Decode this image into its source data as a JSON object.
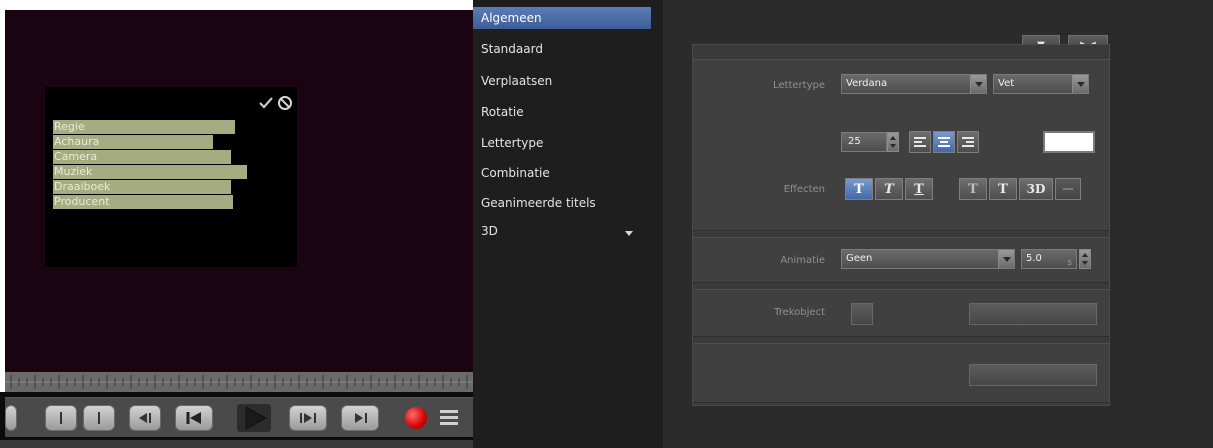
{
  "preview": {
    "title_lines": [
      "Regie",
      "Achaura",
      "Camera",
      "Muziek",
      "Draaiboek",
      "Producent"
    ]
  },
  "transport": {
    "buttons": [
      {
        "icon": "mark-in-icon"
      },
      {
        "icon": "mark-out-icon"
      },
      {
        "icon": "go-to-start-icon"
      },
      {
        "icon": "previous-marker-icon"
      },
      {
        "icon": "play-icon"
      },
      {
        "icon": "next-marker-icon"
      },
      {
        "icon": "go-to-end-icon"
      },
      {
        "icon": "record-icon"
      },
      {
        "icon": "menu-icon"
      }
    ]
  },
  "menu": {
    "items": [
      {
        "label": "Algemeen",
        "selected": true
      },
      {
        "label": "Standaard"
      },
      {
        "label": "Verplaatsen"
      },
      {
        "label": "Rotatie"
      },
      {
        "label": "Lettertype"
      },
      {
        "label": "Combinatie"
      },
      {
        "label": "Geanimeerde titels"
      },
      {
        "label": "3D"
      }
    ]
  },
  "props": {
    "top_buttons": [
      {
        "label": "▼"
      },
      {
        "label": "▶◀"
      }
    ],
    "font_section": {
      "lettertype_label": "Lettertype",
      "font_value": "Verdana",
      "style_value": "Vet",
      "size_value": "25",
      "align_options": [
        "align-left-icon",
        "align-center-icon",
        "align-right-icon"
      ],
      "align_selected": "align-center-icon",
      "text_color": "#ffffff"
    },
    "effects_section": {
      "label": "Effecten",
      "buttons": [
        {
          "label": "T",
          "state": "on"
        },
        {
          "label": "T",
          "state": "normal"
        },
        {
          "label": "T",
          "state": "normal"
        },
        {
          "label": "T",
          "state": "normal"
        },
        {
          "label": "T",
          "state": "normal"
        },
        {
          "label": "3D",
          "state": "normal"
        }
      ]
    },
    "animation_section": {
      "label": "Animatie",
      "value": "Geen",
      "duration": "5.0",
      "unit": "s"
    },
    "object_section": {
      "label": "Trekobject"
    }
  },
  "colors": {
    "menu_selected": "#4d6eaa",
    "title_bar_green": "#a5ac82",
    "record_red": "#d40000"
  }
}
